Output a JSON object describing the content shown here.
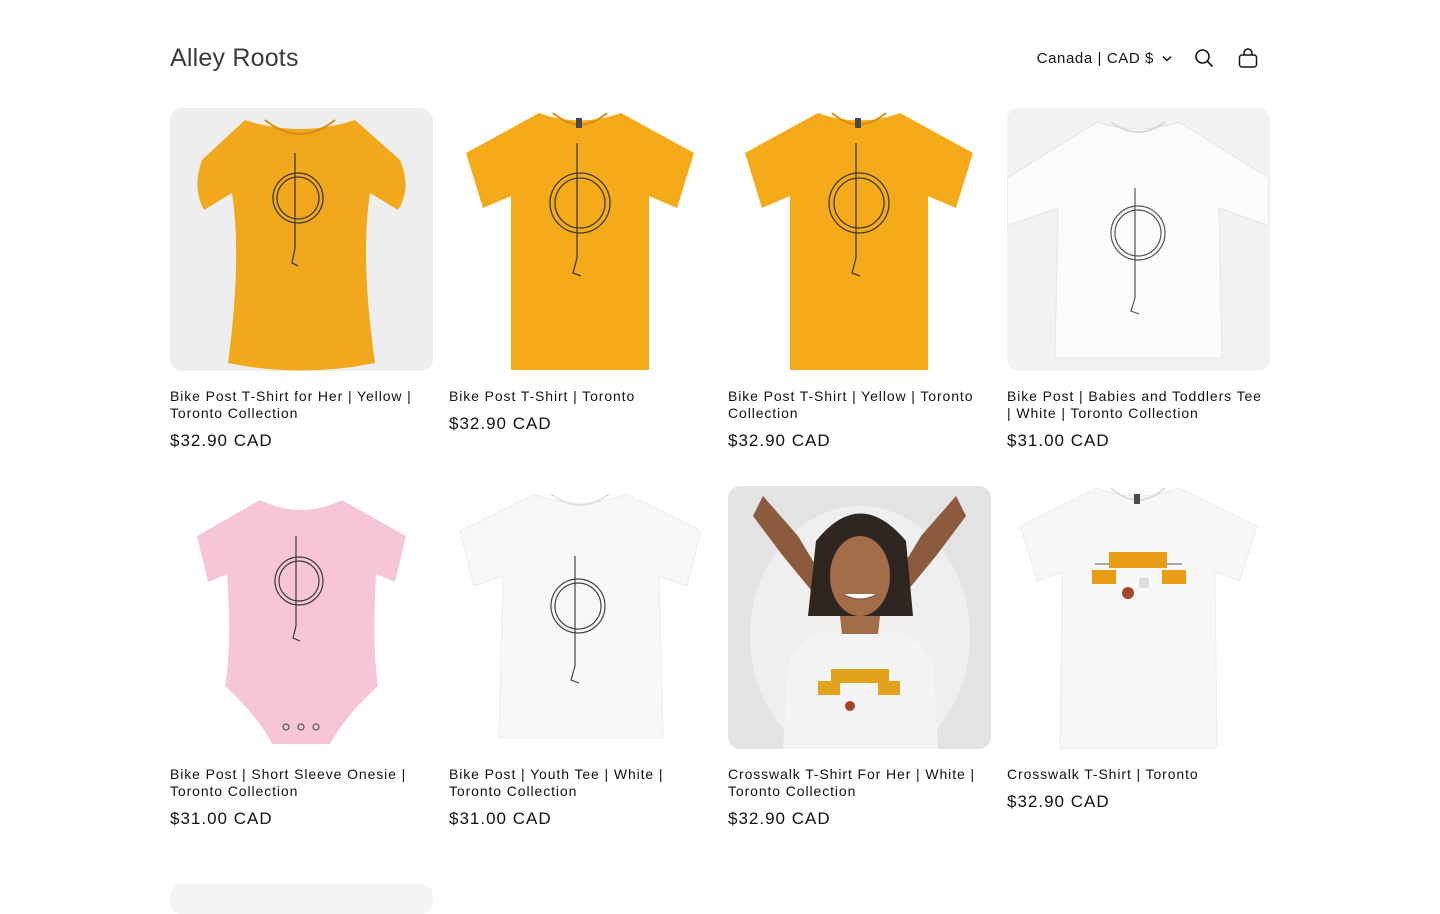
{
  "store": {
    "name": "Alley Roots"
  },
  "header": {
    "currency_label": "Canada | CAD $",
    "icons": [
      "chevron-down-icon",
      "search-icon",
      "cart-icon"
    ]
  },
  "products": [
    {
      "title": "Bike Post T-Shirt for Her | Yellow | Toronto Collection",
      "price": "$32.90 CAD"
    },
    {
      "title": "Bike Post T-Shirt | Toronto",
      "price": "$32.90 CAD"
    },
    {
      "title": "Bike Post T-Shirt | Yellow | Toronto Collection",
      "price": "$32.90 CAD"
    },
    {
      "title": "Bike Post | Babies and Toddlers Tee | White | Toronto Collection",
      "price": "$31.00 CAD"
    },
    {
      "title": "Bike Post | Short Sleeve Onesie | Toronto Collection",
      "price": "$31.00 CAD"
    },
    {
      "title": "Bike Post | Youth Tee | White | Toronto Collection",
      "price": "$31.00 CAD"
    },
    {
      "title": "Crosswalk T-Shirt For Her | White | Toronto Collection",
      "price": "$32.90 CAD"
    },
    {
      "title": "Crosswalk T-Shirt | Toronto",
      "price": "$32.90 CAD"
    }
  ],
  "colors": {
    "yellow_shirt": "#f5ab19",
    "white_shirt": "#f6f6f6",
    "pink_onesie": "#f6c6d6",
    "text": "#121212"
  }
}
